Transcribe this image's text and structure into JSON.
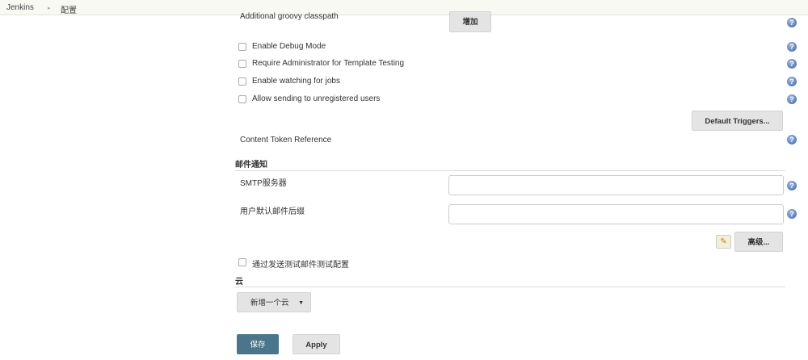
{
  "breadcrumb": {
    "root": "Jenkins",
    "current": "配置"
  },
  "groovy": {
    "label": "Additional groovy classpath",
    "add_button": "增加"
  },
  "checkboxes": [
    {
      "label": "Enable Debug Mode",
      "checked": false
    },
    {
      "label": "Require Administrator for Template Testing",
      "checked": false
    },
    {
      "label": "Enable watching for jobs",
      "checked": false
    },
    {
      "label": "Allow sending to unregistered users",
      "checked": false
    }
  ],
  "default_triggers_button": "Default Triggers...",
  "content_token_label": "Content Token Reference",
  "email": {
    "heading": "邮件通知",
    "smtp_label": "SMTP服务器",
    "smtp_value": "",
    "suffix_label": "用户默认邮件后缀",
    "suffix_value": "",
    "advanced_button": "高级...",
    "test_label": "通过发送测试邮件测试配置"
  },
  "cloud": {
    "heading": "云",
    "add_cloud_button": "新增一个云"
  },
  "footer": {
    "save": "保存",
    "apply": "Apply"
  },
  "colors": {
    "primary": "#4b758b",
    "help": "#3d66a8"
  }
}
